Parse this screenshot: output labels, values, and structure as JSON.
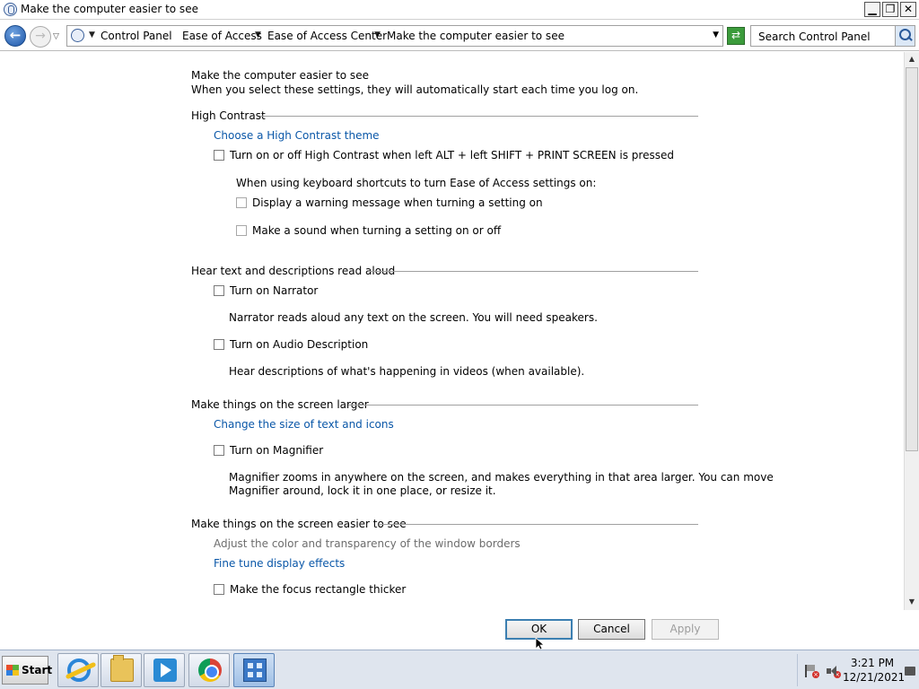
{
  "window": {
    "title": "Make the computer easier to see",
    "minimize_glyph": "▁",
    "maximize_glyph": "❐",
    "close_glyph": "✕"
  },
  "address": {
    "back_glyph": "←",
    "forward_glyph": "→",
    "crumbs": [
      "Control Panel",
      "Ease of Access",
      "Ease of Access Center",
      "Make the computer easier to see"
    ],
    "search_placeholder": "Search Control Panel",
    "refresh_glyph": "⇄"
  },
  "page": {
    "heading": "Make the computer easier to see",
    "subheading": "When you select these settings, they will automatically start each time you log on.",
    "sections": {
      "high_contrast": {
        "title": "High Contrast",
        "link_theme": "Choose a High Contrast theme",
        "cb_toggle": "Turn on or off High Contrast when left ALT + left SHIFT + PRINT SCREEN is pressed",
        "kbd_note": "When using keyboard shortcuts to turn Ease of Access settings on:",
        "cb_warning": "Display a warning message when turning a setting on",
        "cb_sound": "Make a sound when turning a setting on or off"
      },
      "hear": {
        "title": "Hear text and descriptions read aloud",
        "cb_narrator": "Turn on Narrator",
        "narrator_desc": "Narrator reads aloud any text on the screen. You will need speakers.",
        "cb_audio_desc": "Turn on Audio Description",
        "audio_desc": "Hear descriptions of what's happening in videos (when available)."
      },
      "larger": {
        "title": "Make things on the screen larger",
        "link_size": "Change the size of text and icons",
        "cb_magnifier": "Turn on Magnifier",
        "magnifier_desc_1": "Magnifier zooms in anywhere on the screen, and makes everything in that area larger. You can move",
        "magnifier_desc_2": "Magnifier around, lock it in one place, or resize it."
      },
      "easier": {
        "title": "Make things on the screen easier to see",
        "adjust_color": "Adjust the color and transparency of the window borders",
        "link_fine_tune": "Fine tune display effects",
        "cb_focus": "Make the focus rectangle thicker"
      }
    }
  },
  "buttons": {
    "ok": "OK",
    "cancel": "Cancel",
    "apply": "Apply"
  },
  "taskbar": {
    "start_label": "Start",
    "time": "3:21 PM",
    "date": "12/21/2021"
  },
  "scrollbar": {
    "up_glyph": "▲",
    "down_glyph": "▼"
  }
}
